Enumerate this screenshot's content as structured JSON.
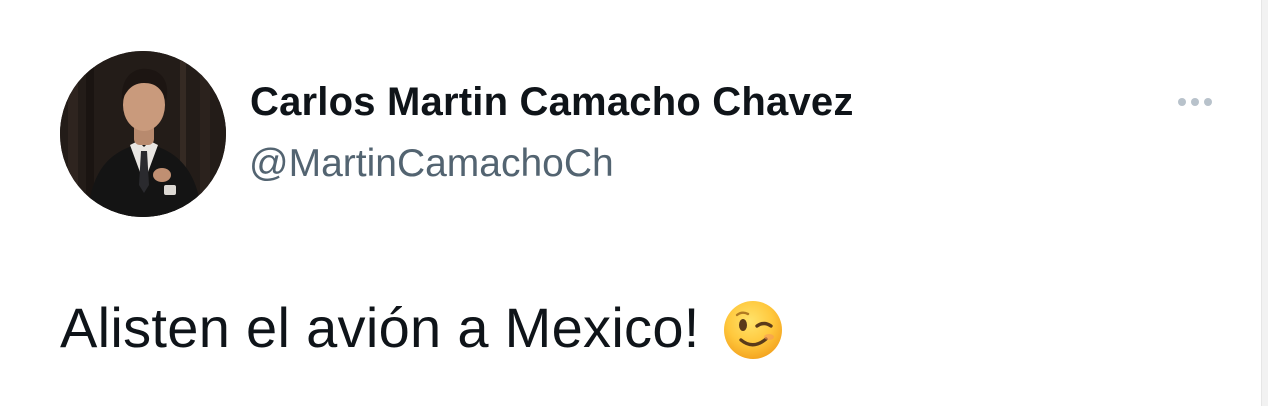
{
  "tweet": {
    "display_name": "Carlos Martin Camacho Chavez",
    "handle": "@MartinCamachoCh",
    "text": "Alisten el avión a Mexico!",
    "emoji": "winking-face",
    "more_icon": "more-horizontal-icon",
    "avatar": "profile-photo"
  },
  "colors": {
    "text_primary": "#0f1419",
    "text_secondary": "#536471",
    "more_dots": "#b8c2cb",
    "background": "#ffffff"
  }
}
